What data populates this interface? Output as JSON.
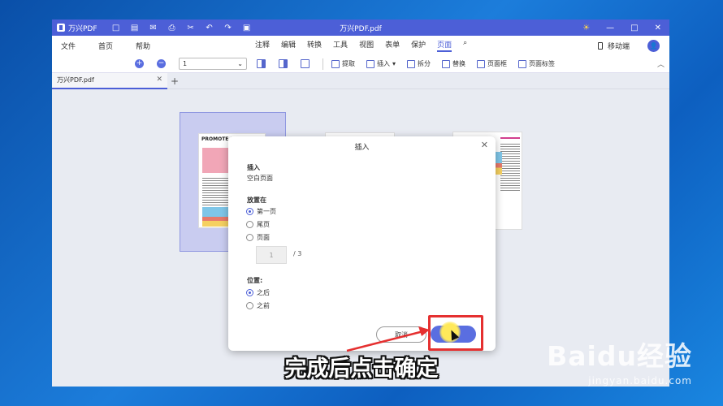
{
  "app": {
    "logo_text": "万兴PDF",
    "doc_title": "万兴PDF.pdf",
    "quick_access": [
      "□",
      "▤",
      "✉",
      "⎙",
      "✂",
      "↶",
      "↷",
      "▣"
    ]
  },
  "menubar": {
    "left": [
      "文件",
      "首页",
      "帮助"
    ],
    "center": [
      "注释",
      "编辑",
      "转换",
      "工具",
      "视图",
      "表单",
      "保护",
      "页面"
    ],
    "active": "页面",
    "mobile": "移动端"
  },
  "toolbar": {
    "page_value": "1",
    "tools": [
      "提取",
      "插入",
      "拆分",
      "替换",
      "页面框",
      "页面标签"
    ]
  },
  "tab": {
    "label": "万兴PDF.pdf"
  },
  "page_thumb": {
    "promo_text": "PROMOTE P"
  },
  "dialog": {
    "title": "插入",
    "insert_label": "插入",
    "insert_value": "空白页面",
    "place_label": "放置在",
    "place_options": [
      "第一页",
      "尾页",
      "页面"
    ],
    "page_input": "1",
    "page_total": "/ 3",
    "position_label": "位置:",
    "position_options": [
      "之后",
      "之前"
    ],
    "cancel": "取消"
  },
  "caption": "完成后点击确定",
  "watermark": {
    "brand": "Baidu经验",
    "url": "jingyan.baidu.com"
  }
}
